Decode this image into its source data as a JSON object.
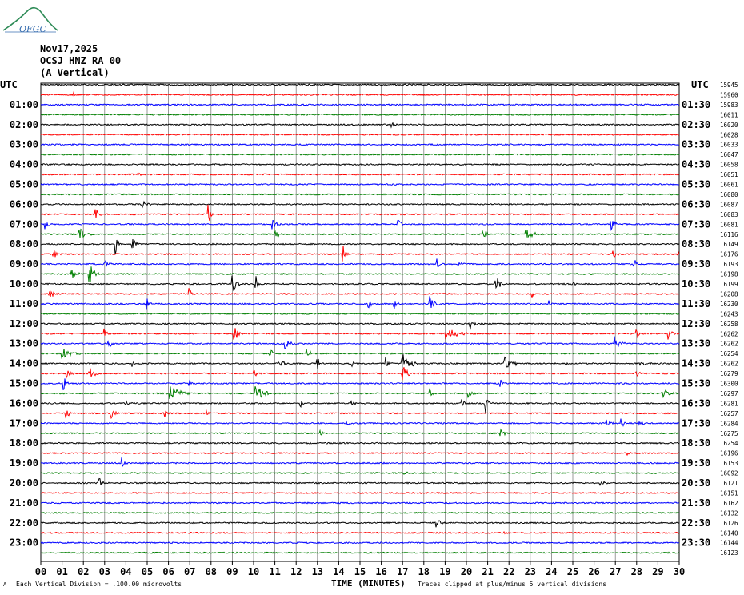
{
  "logo": {
    "text": "OFGC"
  },
  "header": {
    "date": "Nov17,2025",
    "station": "OCSJ HNZ RA 00",
    "component": "(A Vertical)"
  },
  "colors": {
    "cycle": [
      "#000000",
      "#ff0000",
      "#0000ff",
      "#007f00"
    ],
    "grid": "#808080"
  },
  "chart_data": {
    "type": "line",
    "title": "",
    "left_axis_title": "UTC",
    "right_axis_title": "UTC",
    "left_labels": [
      "01:00",
      "02:00",
      "03:00",
      "04:00",
      "05:00",
      "06:00",
      "07:00",
      "08:00",
      "09:00",
      "10:00",
      "11:00",
      "12:00",
      "13:00",
      "14:00",
      "15:00",
      "16:00",
      "17:00",
      "18:00",
      "19:00",
      "20:00",
      "21:00",
      "22:00",
      "23:00"
    ],
    "right_labels": [
      "01:30",
      "02:30",
      "03:30",
      "04:30",
      "05:30",
      "06:30",
      "07:30",
      "08:30",
      "09:30",
      "10:30",
      "11:30",
      "12:30",
      "13:30",
      "14:30",
      "15:30",
      "16:30",
      "17:30",
      "18:30",
      "19:30",
      "20:30",
      "21:30",
      "22:30",
      "23:30"
    ],
    "trace_counts": [
      "15945",
      "15960",
      "15983",
      "16011",
      "16020",
      "16028",
      "16033",
      "16047",
      "16058",
      "16051",
      "16061",
      "16080",
      "16087",
      "16083",
      "16081",
      "16116",
      "16149",
      "16176",
      "16193",
      "16198",
      "16199",
      "16208",
      "16230",
      "16243",
      "16258",
      "16262",
      "16262",
      "16254",
      "16262",
      "16279",
      "16300",
      "16297",
      "16281",
      "16257",
      "16284",
      "16275",
      "16254",
      "16196",
      "16153",
      "16092",
      "16121",
      "16151",
      "16162",
      "16132",
      "16126",
      "16140",
      "16144",
      "16123"
    ],
    "x_ticks": [
      "00",
      "01",
      "02",
      "03",
      "04",
      "05",
      "06",
      "07",
      "08",
      "09",
      "10",
      "11",
      "12",
      "13",
      "14",
      "15",
      "16",
      "17",
      "18",
      "19",
      "20",
      "21",
      "22",
      "23",
      "24",
      "25",
      "26",
      "27",
      "28",
      "29",
      "30"
    ],
    "xlabel": "TIME (MINUTES)",
    "xlim": [
      0,
      30
    ],
    "trace_count": 48,
    "footer_left": "Each Vertical Division = .100.00 microvolts",
    "footer_right": "Traces clipped at plus/minus 5 vertical divisions",
    "corner_mark": "A",
    "events": [
      {
        "trace": 1,
        "t": 1.5,
        "amp": 6,
        "dur": 0.4
      },
      {
        "trace": 4,
        "t": 16.5,
        "amp": 5,
        "dur": 0.3
      },
      {
        "trace": 9,
        "t": 4.5,
        "amp": 3,
        "dur": 0.5
      },
      {
        "trace": 12,
        "t": 4.8,
        "amp": 4,
        "dur": 0.5
      },
      {
        "trace": 13,
        "t": 2.6,
        "amp": 8,
        "dur": 0.3
      },
      {
        "trace": 13,
        "t": 7.9,
        "amp": 12,
        "dur": 0.3
      },
      {
        "trace": 14,
        "t": 0.2,
        "amp": 8,
        "dur": 0.4
      },
      {
        "trace": 14,
        "t": 10.9,
        "amp": 8,
        "dur": 0.4
      },
      {
        "trace": 14,
        "t": 16.8,
        "amp": 6,
        "dur": 0.4
      },
      {
        "trace": 14,
        "t": 26.8,
        "amp": 11,
        "dur": 0.4
      },
      {
        "trace": 15,
        "t": 1.8,
        "amp": 12,
        "dur": 0.6
      },
      {
        "trace": 15,
        "t": 11.0,
        "amp": 6,
        "dur": 0.5
      },
      {
        "trace": 15,
        "t": 20.8,
        "amp": 5,
        "dur": 0.6
      },
      {
        "trace": 15,
        "t": 22.8,
        "amp": 9,
        "dur": 0.8
      },
      {
        "trace": 16,
        "t": 3.5,
        "amp": 12,
        "dur": 0.4
      },
      {
        "trace": 16,
        "t": 4.3,
        "amp": 10,
        "dur": 0.6
      },
      {
        "trace": 17,
        "t": 0.6,
        "amp": 6,
        "dur": 0.4
      },
      {
        "trace": 17,
        "t": 14.2,
        "amp": 14,
        "dur": 0.3
      },
      {
        "trace": 17,
        "t": 26.9,
        "amp": 8,
        "dur": 0.4
      },
      {
        "trace": 17,
        "t": 29.9,
        "amp": 6,
        "dur": 0.3
      },
      {
        "trace": 18,
        "t": 3.0,
        "amp": 5,
        "dur": 0.5
      },
      {
        "trace": 18,
        "t": 18.6,
        "amp": 8,
        "dur": 0.3
      },
      {
        "trace": 18,
        "t": 19.6,
        "amp": 7,
        "dur": 0.3
      },
      {
        "trace": 18,
        "t": 27.9,
        "amp": 7,
        "dur": 0.3
      },
      {
        "trace": 19,
        "t": 1.4,
        "amp": 10,
        "dur": 0.5
      },
      {
        "trace": 19,
        "t": 2.3,
        "amp": 14,
        "dur": 0.6
      },
      {
        "trace": 20,
        "t": 9.0,
        "amp": 14,
        "dur": 0.5
      },
      {
        "trace": 20,
        "t": 10.1,
        "amp": 10,
        "dur": 0.4
      },
      {
        "trace": 20,
        "t": 21.4,
        "amp": 12,
        "dur": 0.4
      },
      {
        "trace": 20,
        "t": 25.0,
        "amp": 4,
        "dur": 0.5
      },
      {
        "trace": 21,
        "t": 0.4,
        "amp": 5,
        "dur": 0.6
      },
      {
        "trace": 21,
        "t": 7.0,
        "amp": 8,
        "dur": 0.3
      },
      {
        "trace": 21,
        "t": 23.1,
        "amp": 9,
        "dur": 0.3
      },
      {
        "trace": 22,
        "t": 5.0,
        "amp": 8,
        "dur": 0.3
      },
      {
        "trace": 22,
        "t": 15.4,
        "amp": 6,
        "dur": 0.3
      },
      {
        "trace": 22,
        "t": 16.6,
        "amp": 7,
        "dur": 0.3
      },
      {
        "trace": 22,
        "t": 18.3,
        "amp": 10,
        "dur": 0.6
      },
      {
        "trace": 22,
        "t": 23.9,
        "amp": 4,
        "dur": 0.3
      },
      {
        "trace": 24,
        "t": 20.2,
        "amp": 7,
        "dur": 0.6
      },
      {
        "trace": 25,
        "t": 3.0,
        "amp": 6,
        "dur": 0.3
      },
      {
        "trace": 25,
        "t": 9.1,
        "amp": 10,
        "dur": 0.4
      },
      {
        "trace": 25,
        "t": 19.0,
        "amp": 7,
        "dur": 1.6
      },
      {
        "trace": 25,
        "t": 28.0,
        "amp": 6,
        "dur": 0.3
      },
      {
        "trace": 25,
        "t": 29.5,
        "amp": 12,
        "dur": 0.3
      },
      {
        "trace": 26,
        "t": 3.2,
        "amp": 6,
        "dur": 0.3
      },
      {
        "trace": 26,
        "t": 11.5,
        "amp": 9,
        "dur": 0.4
      },
      {
        "trace": 26,
        "t": 27.0,
        "amp": 9,
        "dur": 0.6
      },
      {
        "trace": 27,
        "t": 1.0,
        "amp": 8,
        "dur": 1.0
      },
      {
        "trace": 27,
        "t": 10.8,
        "amp": 6,
        "dur": 0.3
      },
      {
        "trace": 27,
        "t": 12.5,
        "amp": 7,
        "dur": 0.4
      },
      {
        "trace": 28,
        "t": 4.3,
        "amp": 5,
        "dur": 0.3
      },
      {
        "trace": 28,
        "t": 11.2,
        "amp": 12,
        "dur": 0.4
      },
      {
        "trace": 28,
        "t": 13.0,
        "amp": 8,
        "dur": 0.3
      },
      {
        "trace": 28,
        "t": 14.6,
        "amp": 5,
        "dur": 0.3
      },
      {
        "trace": 28,
        "t": 16.2,
        "amp": 10,
        "dur": 0.4
      },
      {
        "trace": 28,
        "t": 17.0,
        "amp": 14,
        "dur": 0.9
      },
      {
        "trace": 28,
        "t": 21.8,
        "amp": 10,
        "dur": 0.9
      },
      {
        "trace": 28,
        "t": 24.6,
        "amp": 5,
        "dur": 0.3
      },
      {
        "trace": 28,
        "t": 28.2,
        "amp": 5,
        "dur": 0.5
      },
      {
        "trace": 29,
        "t": 1.2,
        "amp": 6,
        "dur": 0.5
      },
      {
        "trace": 29,
        "t": 2.3,
        "amp": 8,
        "dur": 0.6
      },
      {
        "trace": 29,
        "t": 10.0,
        "amp": 6,
        "dur": 0.4
      },
      {
        "trace": 29,
        "t": 17.0,
        "amp": 14,
        "dur": 0.6
      },
      {
        "trace": 29,
        "t": 28.0,
        "amp": 5,
        "dur": 0.3
      },
      {
        "trace": 30,
        "t": 1.1,
        "amp": 9,
        "dur": 0.3
      },
      {
        "trace": 30,
        "t": 7.0,
        "amp": 5,
        "dur": 0.3
      },
      {
        "trace": 30,
        "t": 21.6,
        "amp": 6,
        "dur": 0.3
      },
      {
        "trace": 31,
        "t": 6.1,
        "amp": 12,
        "dur": 0.9
      },
      {
        "trace": 31,
        "t": 10.1,
        "amp": 12,
        "dur": 0.9
      },
      {
        "trace": 31,
        "t": 18.3,
        "amp": 6,
        "dur": 0.4
      },
      {
        "trace": 31,
        "t": 20.1,
        "amp": 6,
        "dur": 0.4
      },
      {
        "trace": 31,
        "t": 29.2,
        "amp": 8,
        "dur": 0.7
      },
      {
        "trace": 32,
        "t": 4.0,
        "amp": 5,
        "dur": 0.3
      },
      {
        "trace": 32,
        "t": 12.2,
        "amp": 6,
        "dur": 0.3
      },
      {
        "trace": 32,
        "t": 14.6,
        "amp": 6,
        "dur": 0.3
      },
      {
        "trace": 32,
        "t": 19.8,
        "amp": 6,
        "dur": 0.3
      },
      {
        "trace": 32,
        "t": 20.9,
        "amp": 13,
        "dur": 0.4
      },
      {
        "trace": 33,
        "t": 1.2,
        "amp": 6,
        "dur": 0.4
      },
      {
        "trace": 33,
        "t": 3.3,
        "amp": 7,
        "dur": 0.4
      },
      {
        "trace": 33,
        "t": 5.8,
        "amp": 6,
        "dur": 0.4
      },
      {
        "trace": 33,
        "t": 7.8,
        "amp": 4,
        "dur": 0.3
      },
      {
        "trace": 34,
        "t": 14.4,
        "amp": 5,
        "dur": 0.3
      },
      {
        "trace": 34,
        "t": 26.6,
        "amp": 6,
        "dur": 0.4
      },
      {
        "trace": 34,
        "t": 27.3,
        "amp": 7,
        "dur": 0.3
      },
      {
        "trace": 34,
        "t": 28.1,
        "amp": 6,
        "dur": 0.4
      },
      {
        "trace": 35,
        "t": 13.1,
        "amp": 5,
        "dur": 0.3
      },
      {
        "trace": 35,
        "t": 21.6,
        "amp": 8,
        "dur": 0.4
      },
      {
        "trace": 37,
        "t": 27.6,
        "amp": 3,
        "dur": 0.3
      },
      {
        "trace": 38,
        "t": 3.8,
        "amp": 7,
        "dur": 0.3
      },
      {
        "trace": 39,
        "t": 17.1,
        "amp": 4,
        "dur": 0.3
      },
      {
        "trace": 40,
        "t": 2.7,
        "amp": 9,
        "dur": 0.4
      },
      {
        "trace": 40,
        "t": 26.3,
        "amp": 4,
        "dur": 0.6
      },
      {
        "trace": 44,
        "t": 18.6,
        "amp": 7,
        "dur": 0.4
      },
      {
        "trace": 45,
        "t": 21.8,
        "amp": 3,
        "dur": 0.3
      }
    ]
  }
}
